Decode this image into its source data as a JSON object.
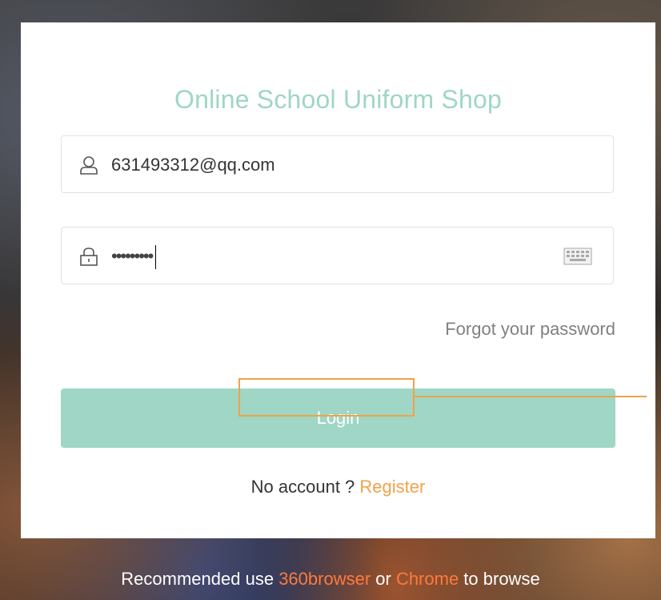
{
  "title": "Online School Uniform Shop",
  "username": {
    "value": "631493312@qq.com",
    "icon": "user-icon"
  },
  "password": {
    "value": "•••••••••",
    "icon": "lock-icon",
    "keyboard_icon": "keyboard-icon"
  },
  "forgot_label": "Forgot your password",
  "login_label": "Login",
  "register": {
    "prompt": "No account ? ",
    "link": "Register"
  },
  "footer": {
    "prefix": "Recommended use ",
    "browser1": "360browser",
    "middle": " or ",
    "browser2": "Chrome",
    "suffix": " to browse"
  },
  "colors": {
    "accent": "#9fd6c5",
    "link": "#f0a24a",
    "footer_highlight": "#ff7a3c",
    "annotation": "#f0a24a"
  }
}
